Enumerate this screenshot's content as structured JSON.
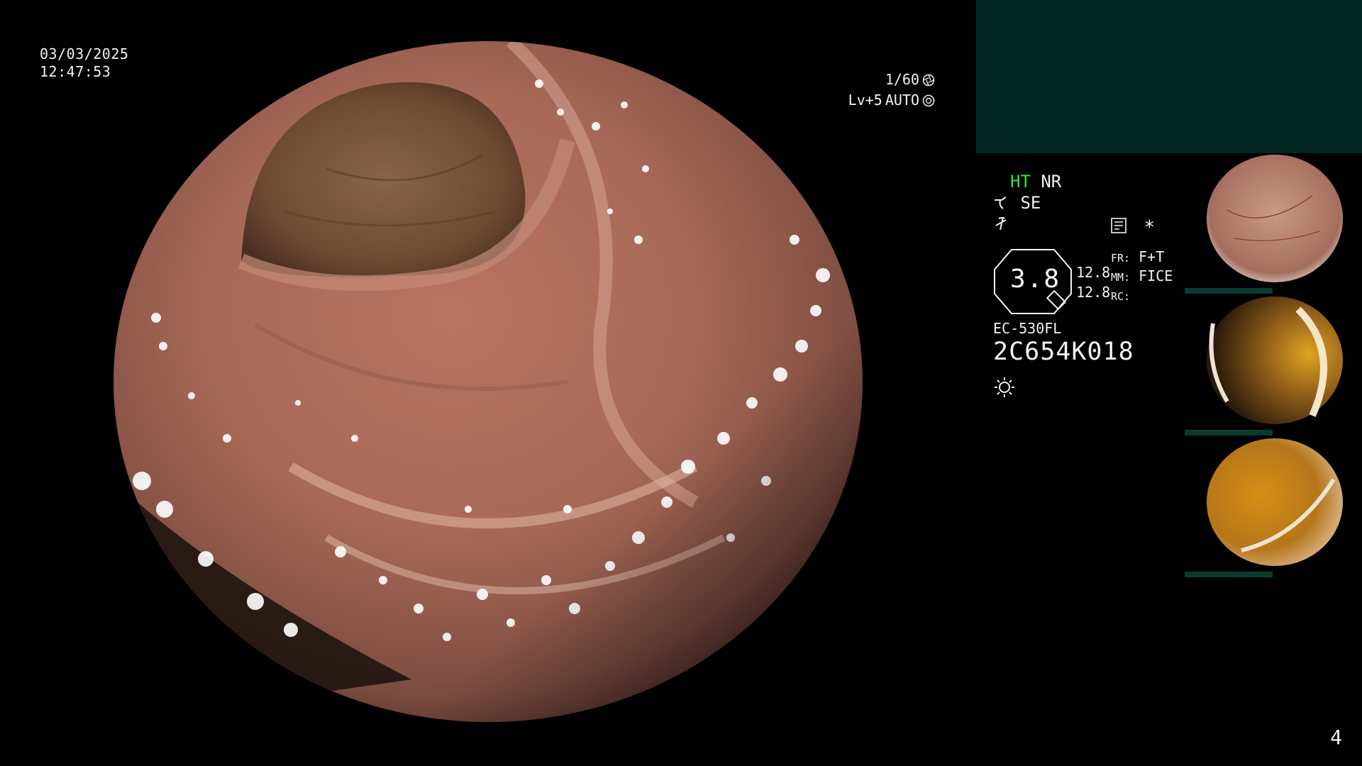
{
  "overlay": {
    "date": "03/03/2025",
    "time": "12:47:53",
    "shutter": "1/60",
    "exposure_level": "Lv+5",
    "exposure_mode": "AUTO"
  },
  "status": {
    "ht": "HT",
    "nr": "NR",
    "se": "SE",
    "gauge_value": "3.8",
    "zoom_a": "12.8",
    "zoom_b": "12.8",
    "fr_label": "FR:",
    "fr_value": "F+T",
    "mm_label": "MM:",
    "mm_value": "FICE",
    "rc_label": "RC:",
    "asterisk": "*",
    "model": "EC-530FL",
    "serial": "2C654K018"
  },
  "thumbnails": [
    {
      "tone": "pink"
    },
    {
      "tone": "dark-yellow"
    },
    {
      "tone": "yellow"
    }
  ],
  "page_number": "4",
  "colors": {
    "background": "#000000",
    "top_panel": "#042622",
    "ht_green": "#33e833",
    "text": "#f2f2f2"
  },
  "icons": [
    "aperture-icon",
    "auto-gear-icon",
    "pump-icon",
    "flash-icon",
    "histogram-icon",
    "sun-icon",
    "scope-tip-icon"
  ]
}
